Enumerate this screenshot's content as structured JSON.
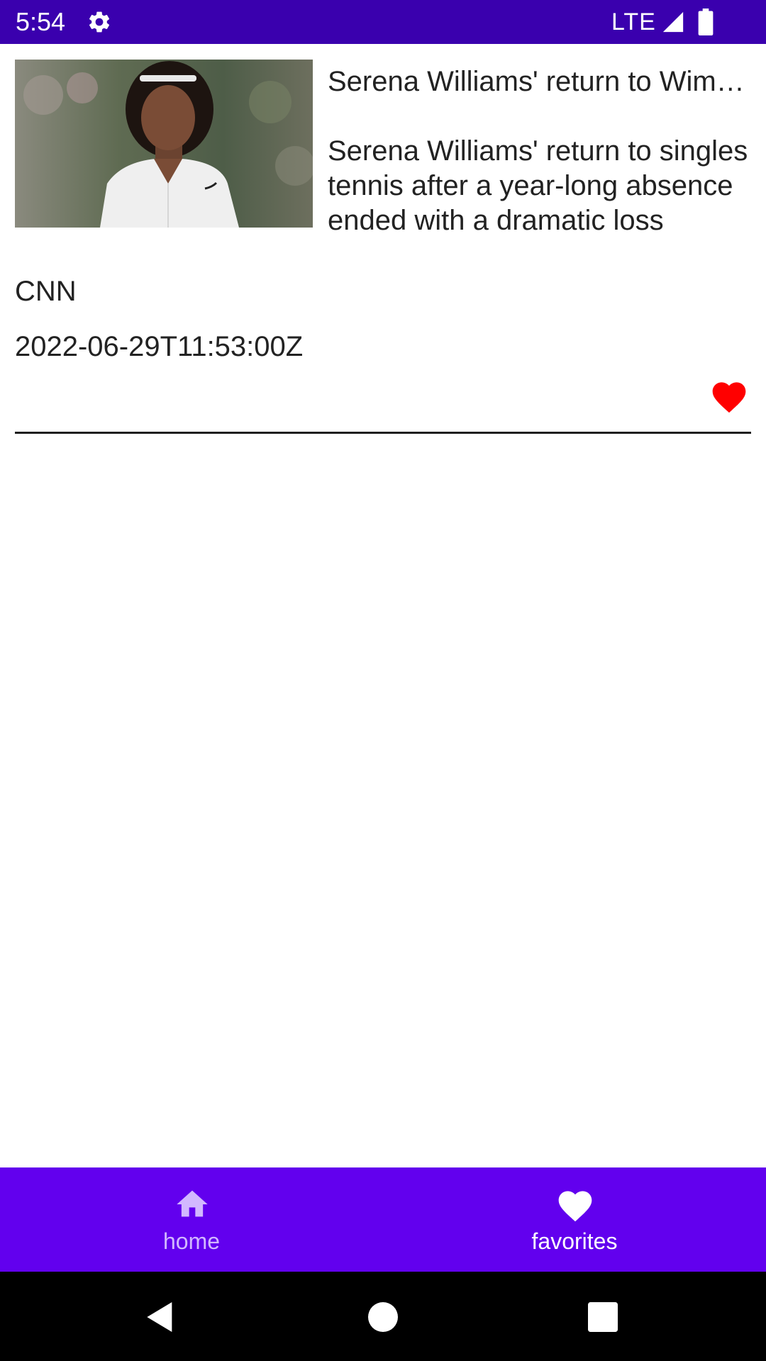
{
  "status_bar": {
    "time": "5:54",
    "network": "LTE",
    "icons": [
      "gear-icon",
      "signal-icon",
      "battery-icon"
    ],
    "background": "#3a00ae"
  },
  "article": {
    "title": "Serena Williams' return to Wimbledon ends in dramatic defeat",
    "summary": "Serena Williams' return to singles tennis after a year-long absence ended with a dramatic loss",
    "source": "CNN",
    "published_at": "2022-06-29T11:53:00Z",
    "favorite_icon": "heart-icon",
    "favorite_color": "#ff0000"
  },
  "bottom_nav": {
    "background": "#6200ee",
    "items": [
      {
        "label": "home",
        "icon": "home-icon",
        "selected": false
      },
      {
        "label": "favorites",
        "icon": "heart-icon",
        "selected": true
      }
    ]
  },
  "system_nav": {
    "buttons": [
      "back-icon",
      "home-circle-icon",
      "recents-icon"
    ]
  }
}
